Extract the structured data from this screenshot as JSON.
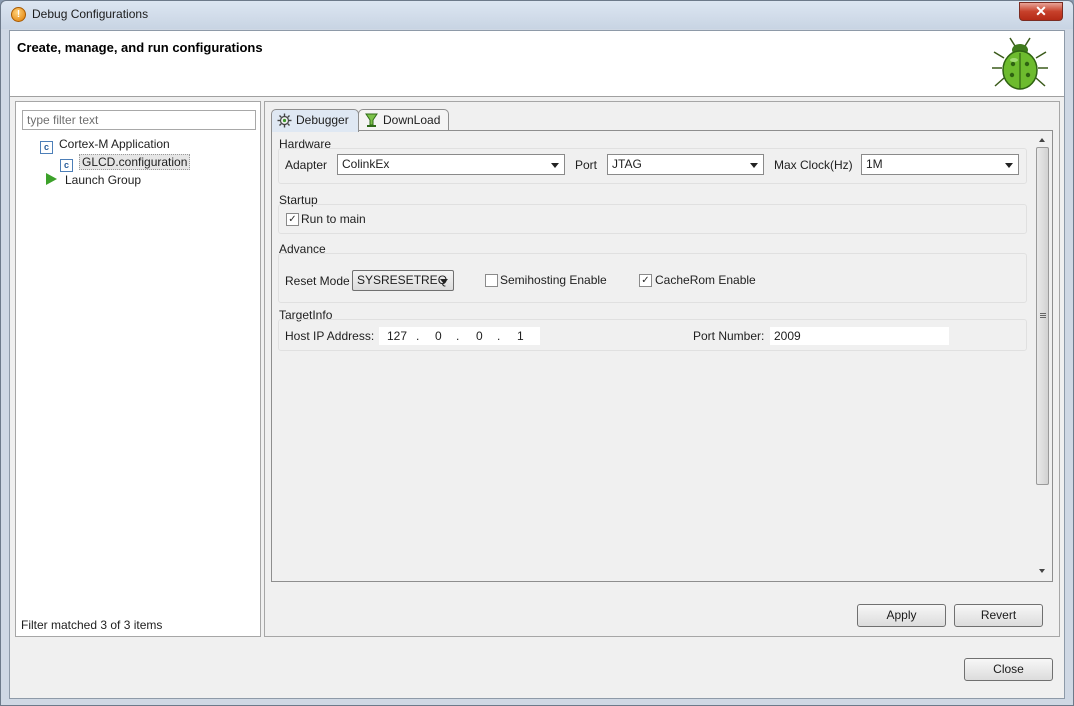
{
  "window": {
    "title": "Debug Configurations",
    "close_glyph": "✕"
  },
  "header": {
    "title": "Create, manage, and run configurations",
    "icon": "bug-icon"
  },
  "left": {
    "filter_placeholder": "type filter text",
    "tree": [
      {
        "label": "Cortex-M Application",
        "icon": "c-config-icon"
      },
      {
        "label": "GLCD.configuration",
        "icon": "c-config-icon",
        "selected": true
      },
      {
        "label": "Launch Group",
        "icon": "launch-group-icon"
      }
    ],
    "status": "Filter matched 3 of 3 items"
  },
  "tabs": [
    {
      "label": "Debugger",
      "active": true,
      "icon": "debugger-gear-icon"
    },
    {
      "label": "DownLoad",
      "active": false,
      "icon": "download-icon"
    }
  ],
  "hardware": {
    "group": "Hardware",
    "adapter_label": "Adapter",
    "adapter_value": "ColinkEx",
    "port_label": "Port",
    "port_value": "JTAG",
    "clock_label": "Max Clock(Hz)",
    "clock_value": "1M"
  },
  "startup": {
    "group": "Startup",
    "run_to_main": "Run to main"
  },
  "advance": {
    "group": "Advance",
    "reset_label": "Reset Mode",
    "reset_value": "SYSRESETREQ",
    "semihosting": "Semihosting Enable",
    "cacherom": "CacheRom Enable"
  },
  "target": {
    "group": "TargetInfo",
    "ip_label": "Host IP Address:",
    "ip": [
      "127",
      "0",
      "0",
      "1"
    ],
    "ip_dot": ".",
    "port_label": "Port Number:",
    "port_value": "2009"
  },
  "buttons": {
    "apply": "Apply",
    "revert": "Revert",
    "close": "Close"
  },
  "colors": {
    "tab_active": "#dfe8f3",
    "check": "#2b2b2b"
  }
}
